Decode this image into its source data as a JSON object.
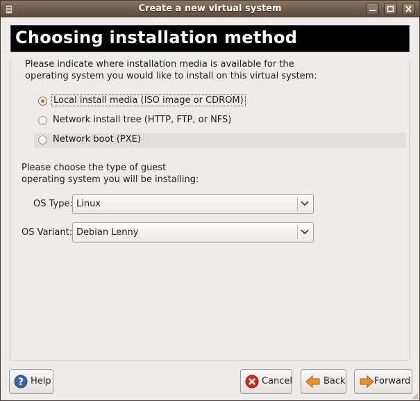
{
  "window": {
    "title": "Create a new virtual system",
    "controls": [
      "minimize-icon",
      "maximize-icon",
      "close-icon"
    ]
  },
  "header": {
    "title": "Choosing installation method"
  },
  "media": {
    "instructions_line1": "Please indicate where installation media is available for the",
    "instructions_line2": "operating system you would like to install on this virtual system:",
    "options": [
      {
        "label": "Local install media (ISO image or CDROM)",
        "selected": true
      },
      {
        "label": "Network install tree (HTTP, FTP, or NFS)",
        "selected": false
      },
      {
        "label": "Network boot (PXE)",
        "selected": false
      }
    ]
  },
  "os": {
    "instructions_line1": "Please choose the type of guest",
    "instructions_line2": "operating system you will be installing:",
    "type_label": "OS Type:",
    "type_value": "Linux",
    "variant_label": "OS Variant:",
    "variant_value": "Debian Lenny"
  },
  "buttons": {
    "help": "Help",
    "cancel": "Cancel",
    "back": "Back",
    "forward": "Forward"
  },
  "colors": {
    "titlebar": "#6e5b48",
    "banner": "#000000",
    "accent": "#c2701c",
    "background": "#edeceb"
  }
}
